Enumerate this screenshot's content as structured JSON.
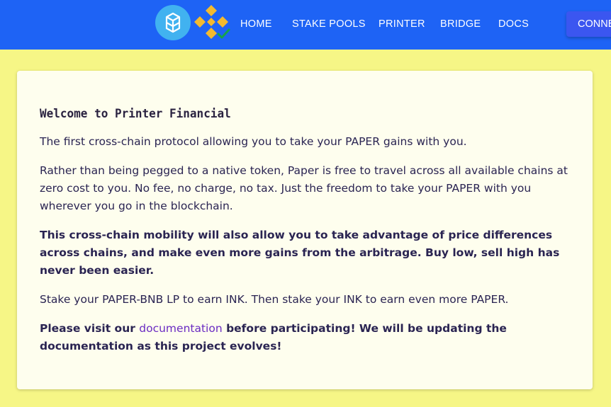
{
  "header": {
    "nav": [
      {
        "label": "HOME"
      },
      {
        "label": "STAKE POOLS"
      },
      {
        "label": "PRINTER"
      },
      {
        "label": "BRIDGE"
      },
      {
        "label": "DOCS"
      }
    ],
    "connect_label": "CONNECT",
    "icons": [
      "fantom-logo-icon",
      "bnb-logo-icon",
      "check-badge-icon"
    ],
    "colors": {
      "bar": "#1e63f5",
      "fantom": "#41b2f0",
      "bnb": "#f3ba2f",
      "check": "#16a34a"
    }
  },
  "card": {
    "title": "Welcome to Printer Financial",
    "p1": "The first cross-chain protocol allowing you to take your PAPER gains with you.",
    "p2": "Rather than being pegged to a native token, Paper is free to travel across all available chains at zero cost to you. No fee, no charge, no tax. Just the freedom to take your PAPER with you wherever you go in the blockchain.",
    "p3": "This cross-chain mobility will also allow you to take advantage of price differences across chains, and make even more gains from the arbitrage. Buy low, sell high has never been easier.",
    "p4": "Stake your PAPER-BNB LP to earn INK. Then stake your INK to earn even more PAPER.",
    "p5_before": "Please visit our ",
    "p5_link": "documentation",
    "p5_after": " before participating! We will be updating the documentation as this project evolves!"
  },
  "colors": {
    "background": "#f6f686",
    "card": "#fefeee",
    "text": "#2a2452",
    "link": "#6a2bc2"
  }
}
